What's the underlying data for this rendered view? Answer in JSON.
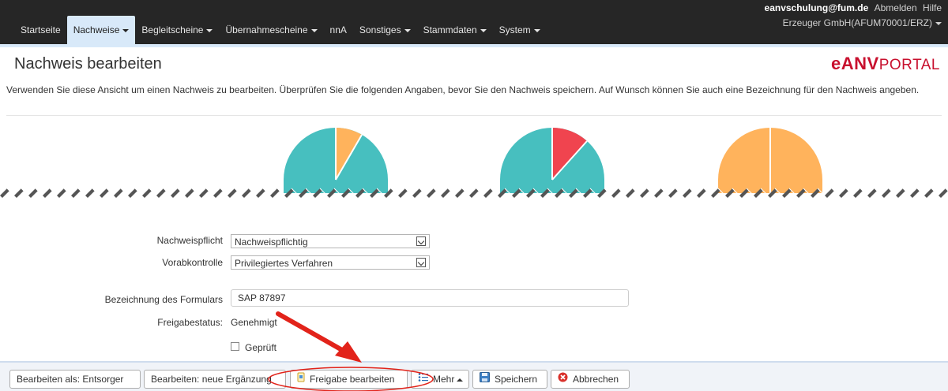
{
  "nav": {
    "items": [
      {
        "label": "Startseite",
        "caret": false
      },
      {
        "label": "Nachweise",
        "caret": true,
        "active": true
      },
      {
        "label": "Begleitscheine",
        "caret": true
      },
      {
        "label": "Übernahmescheine",
        "caret": true
      },
      {
        "label": "nnA",
        "caret": false
      },
      {
        "label": "Sonstiges",
        "caret": true
      },
      {
        "label": "Stammdaten",
        "caret": true
      },
      {
        "label": "System",
        "caret": true
      }
    ],
    "user": "eanvschulung@fum.de",
    "logout": "Abmelden",
    "help": "Hilfe",
    "org": "Erzeuger GmbH(AFUM70001/ERZ)"
  },
  "header": {
    "title": "Nachweis bearbeiten",
    "logo_main": "eANV",
    "logo_sub": "PORTAL",
    "description": "Verwenden Sie diese Ansicht um einen Nachweis zu bearbeiten. Überprüfen Sie die folgenden Angaben, bevor Sie den Nachweis speichern. Auf Wunsch können Sie auch eine Bezeichnung für den Nachweis angeben."
  },
  "form": {
    "nachweispflicht_label": "Nachweispflicht",
    "nachweispflicht_value": "Nachweispflichtig",
    "vorabkontrolle_label": "Vorabkontrolle",
    "vorabkontrolle_value": "Privilegiertes Verfahren",
    "bezeichnung_label": "Bezeichnung des Formulars",
    "bezeichnung_value": "SAP 87897",
    "freigabestatus_label": "Freigabestatus:",
    "freigabestatus_value": "Genehmigt",
    "geprueft_label": "Geprüft",
    "geprueft_checked": false
  },
  "toolbar": {
    "entsorger_label": "Bearbeiten als: Entsorger",
    "ergaenzung_label": "Bearbeiten: neue Ergänzung",
    "freigabe_label": "Freigabe bearbeiten",
    "mehr_label": "Mehr",
    "speichern_label": "Speichern",
    "abbrechen_label": "Abbrechen"
  },
  "colors": {
    "teal": "#47bfbf",
    "orange": "#ffb35c",
    "red": "#f0444f",
    "annotation_red": "#e2231a",
    "navbar": "#262626",
    "active_tab": "#d8e9f9"
  },
  "icons": [
    "freigabe-icon",
    "list-icon",
    "save-icon",
    "cancel-icon",
    "caret-icon"
  ]
}
